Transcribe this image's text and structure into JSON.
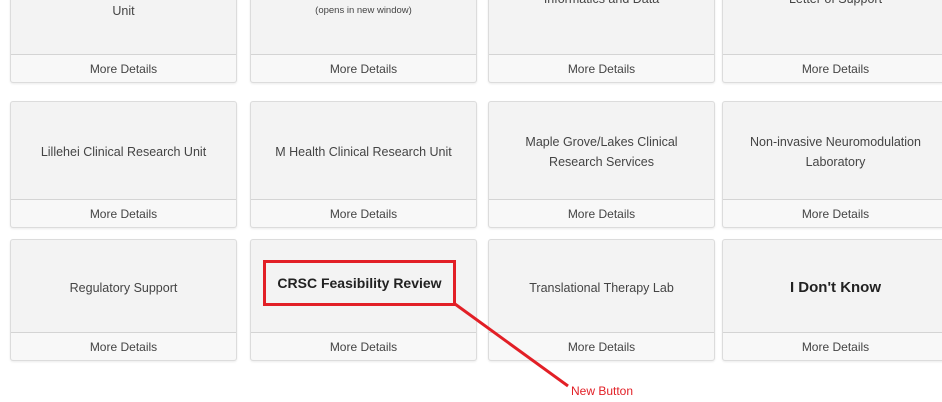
{
  "cards": {
    "row1": [
      {
        "title": "Unit",
        "button": "More Details"
      },
      {
        "title": "(opens in new window)",
        "button": "More Details"
      },
      {
        "title": "Informatics and Data",
        "button": "More Details"
      },
      {
        "title": "Letter of Support",
        "button": "More Details"
      }
    ],
    "row2": [
      {
        "title": "Lillehei Clinical Research Unit",
        "button": "More Details"
      },
      {
        "title": "M Health Clinical Research Unit",
        "button": "More Details"
      },
      {
        "title": "Maple Grove/Lakes Clinical Research Services",
        "button": "More Details"
      },
      {
        "title": "Non-invasive Neuromodulation Laboratory",
        "button": "More Details"
      }
    ],
    "row3": [
      {
        "title": "Regulatory Support",
        "button": "More Details"
      },
      {
        "title": "CRSC Feasibility Review",
        "button": "More Details"
      },
      {
        "title": "Translational Therapy Lab",
        "button": "More Details"
      },
      {
        "title": "I Don't Know",
        "button": "More Details"
      }
    ]
  },
  "annotation": {
    "label": "New Button",
    "color": "#e21f26"
  }
}
